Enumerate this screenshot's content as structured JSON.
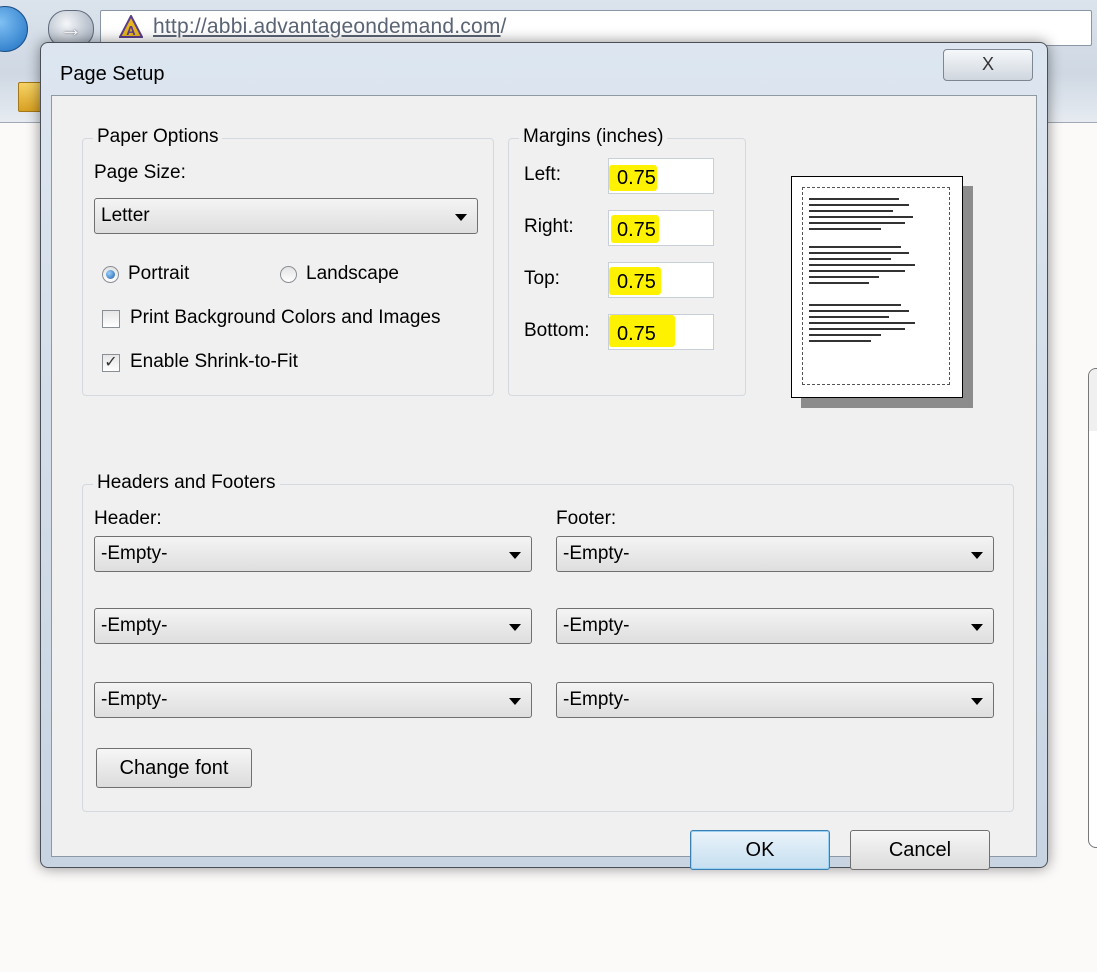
{
  "browser": {
    "url_prefix": "http://abbi.",
    "url_domain": "advantageondemand.com",
    "url_suffix": "/"
  },
  "dialog": {
    "title": "Page Setup",
    "close_label": "X"
  },
  "paper_options": {
    "group_label": "Paper Options",
    "page_size_label": "Page Size:",
    "page_size_value": "Letter",
    "portrait_label": "Portrait",
    "landscape_label": "Landscape",
    "orientation_selected": "Portrait",
    "print_background_label": "Print Background Colors and Images",
    "print_background_checked": false,
    "shrink_to_fit_label": "Enable Shrink-to-Fit",
    "shrink_to_fit_checked": true
  },
  "margins": {
    "group_label": "Margins (inches)",
    "left_label": "Left:",
    "left_value": "0.75",
    "right_label": "Right:",
    "right_value": "0.75",
    "top_label": "Top:",
    "top_value": "0.75",
    "bottom_label": "Bottom:",
    "bottom_value": "0.75",
    "highlight_color": "#fff200"
  },
  "headers_footers": {
    "group_label": "Headers and Footers",
    "header_label": "Header:",
    "footer_label": "Footer:",
    "header_values": [
      "-Empty-",
      "-Empty-",
      "-Empty-"
    ],
    "footer_values": [
      "-Empty-",
      "-Empty-",
      "-Empty-"
    ],
    "change_font_label": "Change font"
  },
  "buttons": {
    "ok_label": "OK",
    "cancel_label": "Cancel"
  }
}
